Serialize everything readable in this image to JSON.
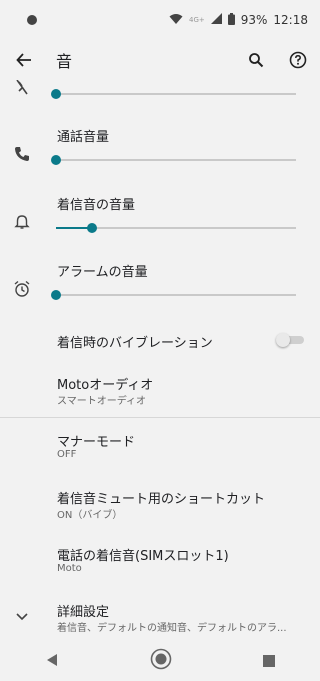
{
  "status_bar": {
    "network": "4G+",
    "battery": "93%",
    "time": "12:18"
  },
  "app_bar": {
    "title": "音"
  },
  "sliders": [
    {
      "label": "",
      "level": 0.0
    },
    {
      "label": "通話音量",
      "level": 0.0
    },
    {
      "label": "着信音の音量",
      "level": 0.15
    },
    {
      "label": "アラームの音量",
      "level": 0.0
    }
  ],
  "vibrate": {
    "label": "着信時のバイブレーション",
    "enabled": false
  },
  "moto_audio": {
    "label": "Motoオーディオ",
    "sub": "スマートオーディオ"
  },
  "manner": {
    "label": "マナーモード",
    "sub": "OFF"
  },
  "mute_shortcut": {
    "label": "着信音ミュート用のショートカット",
    "sub": "ON（バイブ）"
  },
  "ringtone": {
    "label": "電話の着信音(SIMスロット1)",
    "sub": "Moto"
  },
  "advanced": {
    "label": "詳細設定",
    "sub": "着信音、デフォルトの通知音、デフォルトのアラ..."
  },
  "colors": {
    "accent": "#0b7a8a",
    "background": "#f2f2f2"
  }
}
